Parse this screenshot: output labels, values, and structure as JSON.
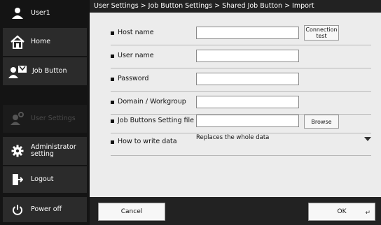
{
  "sidebar": {
    "user": "User1",
    "items": [
      {
        "label": "Home"
      },
      {
        "label": "Job Button"
      },
      {
        "label": "User Settings"
      },
      {
        "label": "Administrator setting"
      },
      {
        "label": "Logout"
      },
      {
        "label": "Power off"
      }
    ]
  },
  "breadcrumb": "User Settings > Job Button Settings > Shared Job Button > Import",
  "form": {
    "host_name": {
      "label": "Host name",
      "value": ""
    },
    "connection_test": "Connection test",
    "user_name": {
      "label": "User name",
      "value": ""
    },
    "password": {
      "label": "Password",
      "value": ""
    },
    "domain": {
      "label": "Domain / Workgroup",
      "value": ""
    },
    "settings_file": {
      "label": "Job Buttons Setting file",
      "value": ""
    },
    "browse": "Browse",
    "write_mode": {
      "label": "How to write data",
      "value": "Replaces the whole data"
    }
  },
  "footer": {
    "cancel": "Cancel",
    "ok": "OK"
  }
}
